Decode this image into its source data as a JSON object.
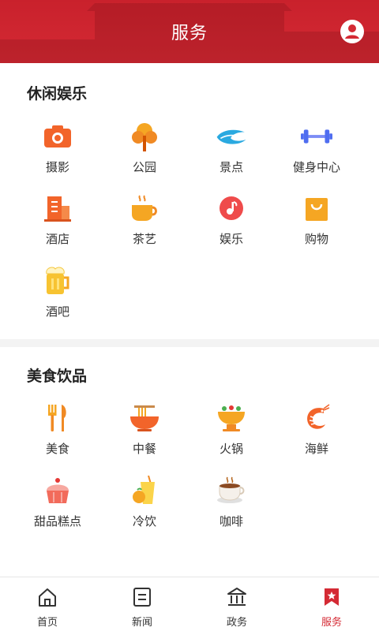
{
  "header": {
    "title": "服务"
  },
  "sections": [
    {
      "title": "休闲娱乐",
      "items": [
        {
          "label": "摄影",
          "icon": "camera-icon"
        },
        {
          "label": "公园",
          "icon": "tree-icon"
        },
        {
          "label": "景点",
          "icon": "wave-icon"
        },
        {
          "label": "健身中心",
          "icon": "dumbbell-icon"
        },
        {
          "label": "酒店",
          "icon": "hotel-icon"
        },
        {
          "label": "茶艺",
          "icon": "tea-cup-icon"
        },
        {
          "label": "娱乐",
          "icon": "music-icon"
        },
        {
          "label": "购物",
          "icon": "shopping-bag-icon"
        },
        {
          "label": "酒吧",
          "icon": "beer-icon"
        }
      ]
    },
    {
      "title": "美食饮品",
      "items": [
        {
          "label": "美食",
          "icon": "fork-knife-icon"
        },
        {
          "label": "中餐",
          "icon": "noodle-bowl-icon"
        },
        {
          "label": "火锅",
          "icon": "hotpot-icon"
        },
        {
          "label": "海鲜",
          "icon": "shrimp-icon"
        },
        {
          "label": "甜品糕点",
          "icon": "cupcake-icon"
        },
        {
          "label": "冷饮",
          "icon": "juice-icon"
        },
        {
          "label": "咖啡",
          "icon": "coffee-icon"
        }
      ]
    }
  ],
  "tabbar": [
    {
      "label": "首页",
      "icon": "home-icon"
    },
    {
      "label": "新闻",
      "icon": "news-icon"
    },
    {
      "label": "政务",
      "icon": "government-icon"
    },
    {
      "label": "服务",
      "icon": "service-icon",
      "active": true
    }
  ],
  "colors": {
    "brand": "#d42a34",
    "orange": "#f26b2a",
    "text": "#333333"
  }
}
